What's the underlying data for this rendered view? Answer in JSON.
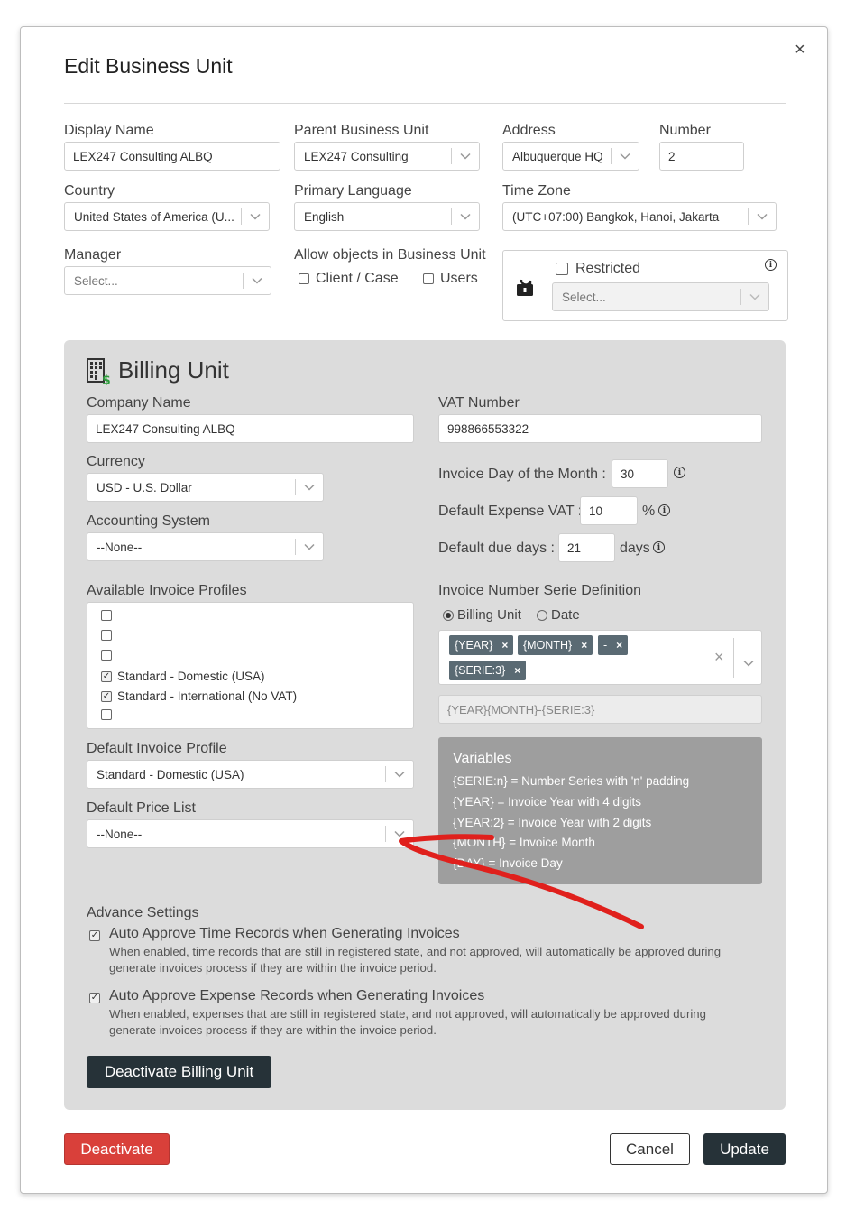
{
  "dialog": {
    "title": "Edit Business Unit",
    "close_icon": "×"
  },
  "top": {
    "display_name": {
      "label": "Display Name",
      "value": "LEX247 Consulting ALBQ"
    },
    "parent_bu": {
      "label": "Parent Business Unit",
      "value": "LEX247 Consulting"
    },
    "address": {
      "label": "Address",
      "value": "Albuquerque HQ"
    },
    "number": {
      "label": "Number",
      "value": "2"
    },
    "country": {
      "label": "Country",
      "value": "United States of America (U..."
    },
    "primary_language": {
      "label": "Primary Language",
      "value": "English"
    },
    "time_zone": {
      "label": "Time Zone",
      "value": "(UTC+07:00) Bangkok, Hanoi, Jakarta"
    },
    "manager": {
      "label": "Manager",
      "placeholder": "Select..."
    },
    "allow_objects": {
      "label": "Allow objects in Business Unit",
      "client_case": "Client / Case",
      "users": "Users"
    },
    "restricted": {
      "label": "Restricted",
      "placeholder": "Select..."
    }
  },
  "billing": {
    "title": "Billing Unit",
    "company_name": {
      "label": "Company Name",
      "value": "LEX247 Consulting ALBQ"
    },
    "vat_number": {
      "label": "VAT Number",
      "value": "998866553322"
    },
    "currency": {
      "label": "Currency",
      "value": "USD - U.S. Dollar"
    },
    "accounting_system": {
      "label": "Accounting System",
      "value": "--None--"
    },
    "invoice_day": {
      "label": "Invoice Day of the Month :",
      "value": "30"
    },
    "default_expense_vat": {
      "label": "Default Expense VAT :",
      "value": "10",
      "unit": "%"
    },
    "default_due_days": {
      "label": "Default due days :",
      "value": "21",
      "unit": "days"
    },
    "available_profiles": {
      "label": "Available Invoice Profiles",
      "items": [
        {
          "label": "",
          "checked": false
        },
        {
          "label": "",
          "checked": false
        },
        {
          "label": "",
          "checked": false
        },
        {
          "label": "Standard - Domestic (USA)",
          "checked": true
        },
        {
          "label": "Standard - International (No VAT)",
          "checked": true
        },
        {
          "label": "",
          "checked": false
        }
      ]
    },
    "serie_definition": {
      "label": "Invoice Number Serie Definition",
      "radio_billing_unit": "Billing Unit",
      "radio_date": "Date",
      "tags": [
        "{YEAR}",
        "{MONTH}",
        "-",
        "{SERIE:3}"
      ],
      "preview": "{YEAR}{MONTH}-{SERIE:3}"
    },
    "default_invoice_profile": {
      "label": "Default Invoice Profile",
      "value": "Standard - Domestic (USA)"
    },
    "default_price_list": {
      "label": "Default Price List",
      "value": "--None--"
    },
    "variables": {
      "title": "Variables",
      "lines": [
        "{SERIE:n} = Number Series with 'n' padding",
        "{YEAR} = Invoice Year with 4 digits",
        "{YEAR:2} = Invoice Year with 2 digits",
        "{MONTH} = Invoice Month",
        "{DAY} = Invoice Day"
      ]
    },
    "advance": {
      "label": "Advance Settings",
      "time": {
        "title": "Auto Approve Time Records when Generating Invoices",
        "desc1": "When enabled, time records that are still in registered state, and not approved, will automatically be approved during",
        "desc2": "generate invoices process if they are within the invoice period."
      },
      "expense": {
        "title": "Auto Approve Expense Records when Generating Invoices",
        "desc1": "When enabled, expenses that are still in registered state, and not approved, will automatically be approved during",
        "desc2": "generate invoices process if they are within the invoice period."
      }
    },
    "deactivate_billing_label": "Deactivate Billing Unit"
  },
  "footer": {
    "deactivate_label": "Deactivate",
    "cancel_label": "Cancel",
    "update_label": "Update"
  },
  "colors": {
    "billing_bg": "#dcdcdc",
    "dark_button": "#263238",
    "danger_button": "#d9403a",
    "annotation_arrow": "#e0201c"
  },
  "icons": {
    "chevron": "chevron-down-icon",
    "lock": "unlock-icon",
    "building": "building-dollar-icon",
    "info": "info-icon"
  }
}
